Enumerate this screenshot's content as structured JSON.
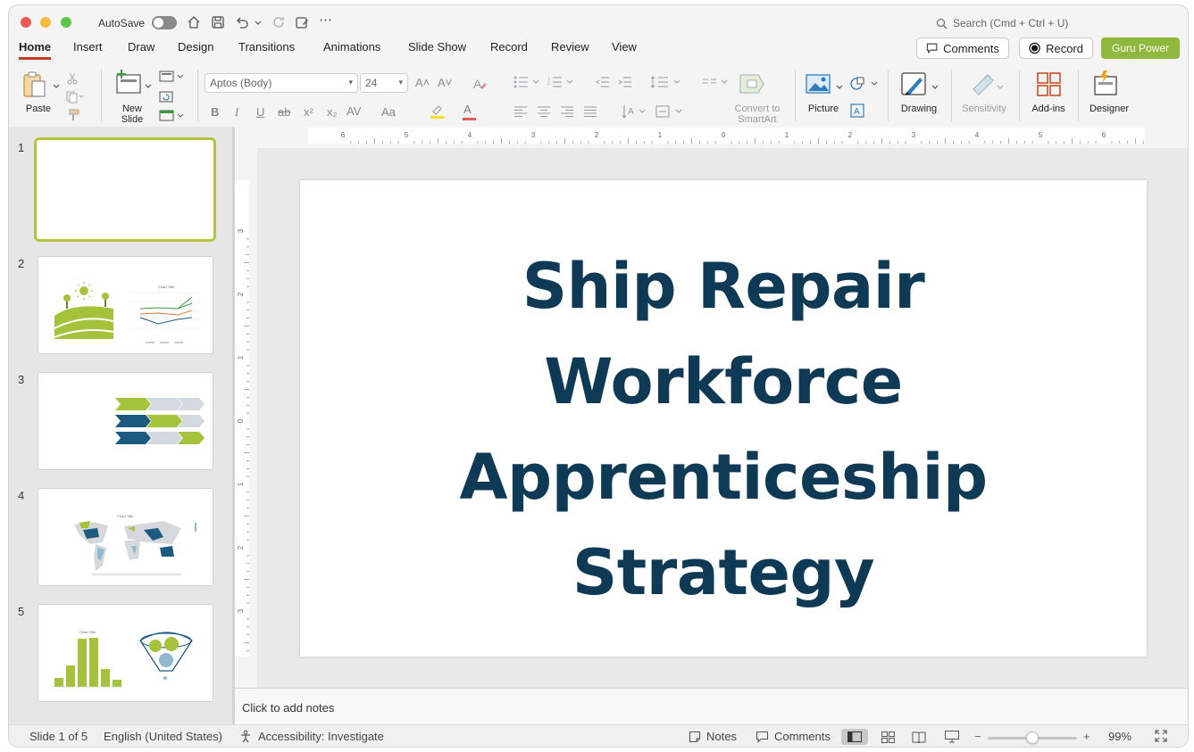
{
  "titlebar": {
    "autosave_label": "AutoSave",
    "search_placeholder": "Search (Cmd + Ctrl + U)",
    "more_glyph": "⋯"
  },
  "tabs": [
    "Home",
    "Insert",
    "Draw",
    "Design",
    "Transitions",
    "Animations",
    "Slide Show",
    "Record",
    "Review",
    "View"
  ],
  "active_tab": "Home",
  "top_buttons": {
    "comments": "Comments",
    "record": "Record",
    "guru": "Guru Power"
  },
  "ribbon": {
    "paste": "Paste",
    "new_slide": "New Slide",
    "font_name": "Aptos (Body)",
    "font_size": "24",
    "convert_smartart": "Convert to SmartArt",
    "picture": "Picture",
    "drawing": "Drawing",
    "sensitivity": "Sensitivity",
    "addins": "Add-ins",
    "designer": "Designer",
    "bold": "B",
    "italic": "I",
    "underline": "U",
    "strike": "ab",
    "super": "x²",
    "sub": "x₂",
    "charspacing": "AV",
    "changecase": "Aa",
    "fontcolor": "A",
    "grow": "A˄",
    "shrink": "A˅"
  },
  "slides": [
    {
      "num": "1"
    },
    {
      "num": "2"
    },
    {
      "num": "3"
    },
    {
      "num": "4",
      "thumb_title": "Chart Title"
    },
    {
      "num": "5",
      "thumb_title": "Chart Title"
    }
  ],
  "thumb2_title": "Chart Title",
  "slide": {
    "title_lines": [
      "Ship Repair",
      "Workforce",
      "Apprenticeship",
      "Strategy"
    ]
  },
  "hruler_labels": [
    "6",
    "5",
    "4",
    "3",
    "2",
    "1",
    "0",
    "1",
    "2",
    "3",
    "4",
    "5",
    "6"
  ],
  "vruler_labels": [
    "3",
    "2",
    "1",
    "0",
    "1",
    "2",
    "3"
  ],
  "notes_placeholder": "Click to add notes",
  "status": {
    "slide_pos": "Slide 1 of 5",
    "language": "English (United States)",
    "accessibility": "Accessibility: Investigate",
    "notes": "Notes",
    "comments": "Comments",
    "zoom": "99%",
    "minus": "−",
    "plus": "+"
  },
  "colors": {
    "accent_red": "#c43e1c",
    "guru_green": "#8fb83c",
    "title_navy": "#0f3a55",
    "theme_green": "#a4c33a",
    "theme_blue": "#1c5a80"
  },
  "zoom_level": 0.5
}
